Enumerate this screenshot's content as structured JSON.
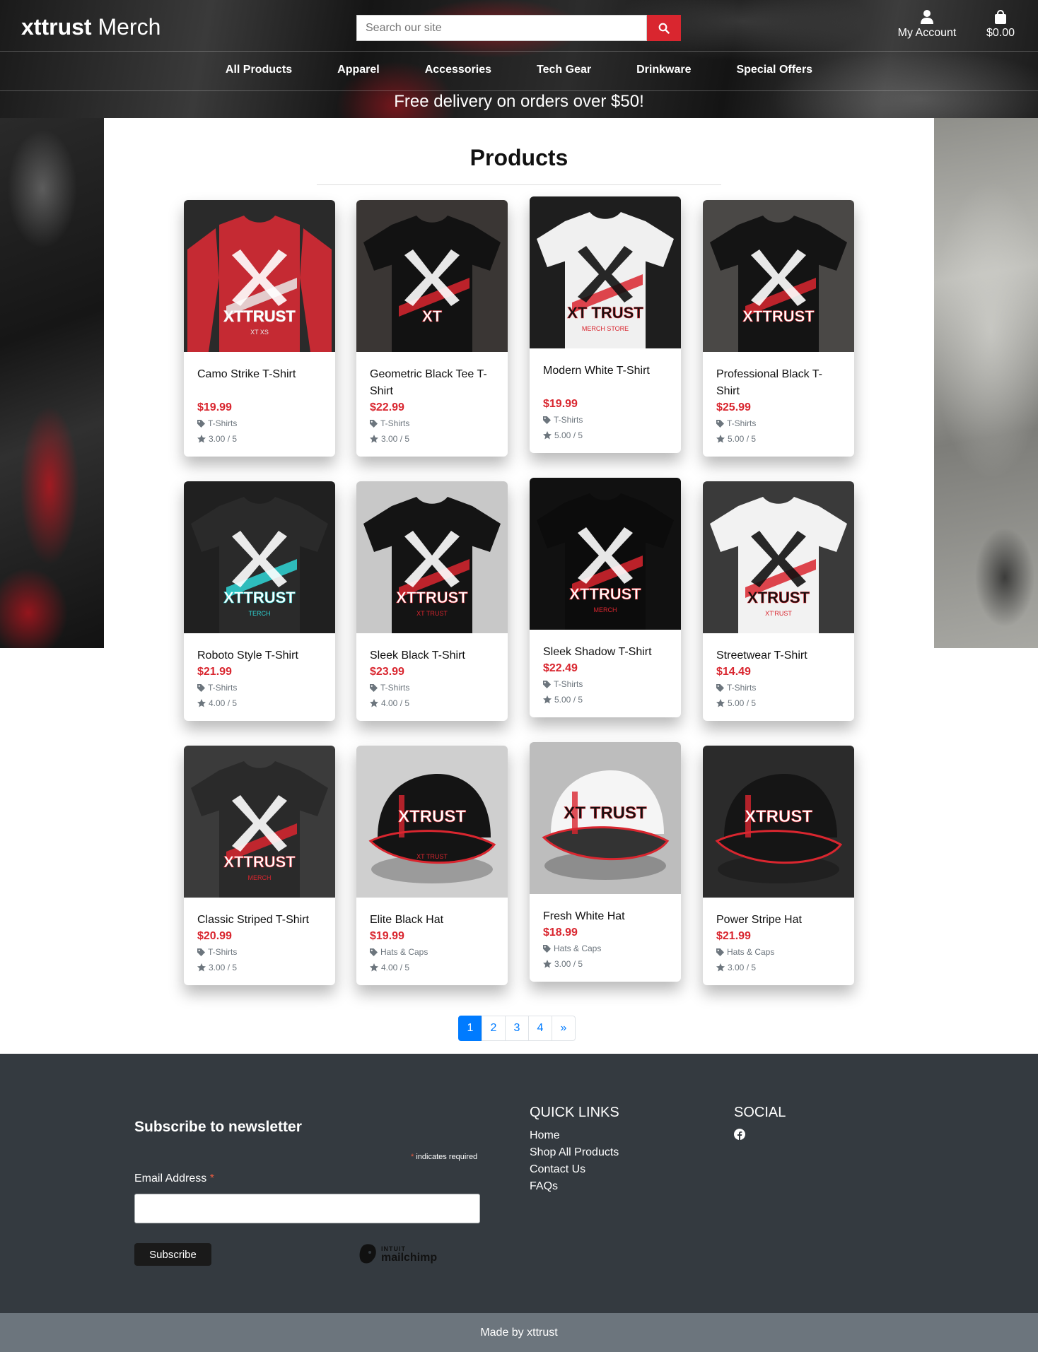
{
  "header": {
    "logo_bold": "xttrust",
    "logo_rest": " Merch",
    "search_placeholder": "Search our site",
    "account_label": "My Account",
    "cart_total": "$0.00",
    "banner": "Free delivery on orders over $50!"
  },
  "nav": [
    "All Products",
    "Apparel",
    "Accessories",
    "Tech Gear",
    "Drinkware",
    "Special Offers"
  ],
  "page_title": "Products",
  "products": [
    {
      "name": "Camo Strike T-Shirt",
      "price": "$19.99",
      "category": "T-Shirts",
      "rating": "3.00 / 5"
    },
    {
      "name": "Geometric Black Tee T-Shirt",
      "price": "$22.99",
      "category": "T-Shirts",
      "rating": "3.00 / 5"
    },
    {
      "name": "Modern White T-Shirt",
      "price": "$19.99",
      "category": "T-Shirts",
      "rating": "5.00 / 5"
    },
    {
      "name": "Professional Black T-Shirt",
      "price": "$25.99",
      "category": "T-Shirts",
      "rating": "5.00 / 5"
    },
    {
      "name": "Roboto Style T-Shirt",
      "price": "$21.99",
      "category": "T-Shirts",
      "rating": "4.00 / 5"
    },
    {
      "name": "Sleek Black T-Shirt",
      "price": "$23.99",
      "category": "T-Shirts",
      "rating": "4.00 / 5"
    },
    {
      "name": "Sleek Shadow T-Shirt",
      "price": "$22.49",
      "category": "T-Shirts",
      "rating": "5.00 / 5"
    },
    {
      "name": "Streetwear T-Shirt",
      "price": "$14.49",
      "category": "T-Shirts",
      "rating": "5.00 / 5"
    },
    {
      "name": "Classic Striped T-Shirt",
      "price": "$20.99",
      "category": "T-Shirts",
      "rating": "3.00 / 5"
    },
    {
      "name": "Elite Black Hat",
      "price": "$19.99",
      "category": "Hats & Caps",
      "rating": "4.00 / 5"
    },
    {
      "name": "Fresh White Hat",
      "price": "$18.99",
      "category": "Hats & Caps",
      "rating": "3.00 / 5"
    },
    {
      "name": "Power Stripe Hat",
      "price": "$21.99",
      "category": "Hats & Caps",
      "rating": "3.00 / 5"
    }
  ],
  "product_art": {
    "brand_text": [
      "XTTRUST",
      "XT",
      "XT TRUST",
      "XTTRUST",
      "XTTRUST",
      "XTTRUST",
      "XTTRUST",
      "XTRUST",
      "XTTRUST",
      "XTRUST",
      "XT TRUST",
      "XTRUST"
    ],
    "secondary_text": [
      "XT  XS",
      "",
      "MERCH STORE",
      "",
      "TERCH",
      "XT TRUST",
      "MERCH",
      "XT'RUST",
      "MERCH",
      "XT TRUST",
      "",
      ""
    ]
  },
  "pagination": {
    "pages": [
      "1",
      "2",
      "3",
      "4"
    ],
    "next": "»",
    "active": "1"
  },
  "footer": {
    "newsletter_title": "Subscribe to newsletter",
    "required_note": "indicates required",
    "required_mark": "*",
    "email_label": "Email Address",
    "subscribe_label": "Subscribe",
    "mailchimp_top": "INTUIT",
    "mailchimp_bottom": "mailchimp",
    "quick_links_title": "QUICK LINKS",
    "quick_links": [
      "Home",
      "Shop All Products",
      "Contact Us",
      "FAQs"
    ],
    "social_title": "SOCIAL",
    "credit": "Made by xttrust"
  },
  "colors": {
    "accent_red": "#d9262f",
    "link_blue": "#007bff",
    "footer_bg": "#343a40",
    "bottom_bar": "#6c757d"
  },
  "icons": [
    "search-icon",
    "user-icon",
    "shopping-bag-icon",
    "tag-icon",
    "star-icon",
    "facebook-icon",
    "mailchimp-icon"
  ]
}
